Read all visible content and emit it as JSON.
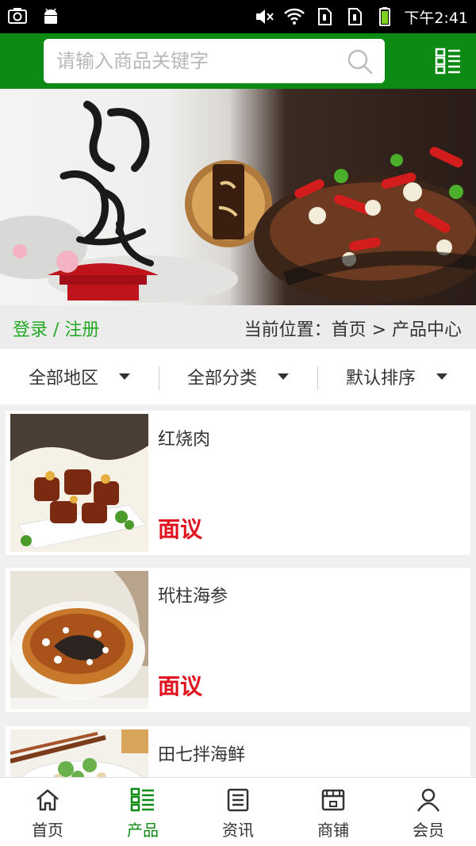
{
  "status_bar": {
    "time": "下午2:41",
    "left_icons": [
      "screenshot-icon",
      "android-icon"
    ],
    "right_icons": [
      "mute-icon",
      "wifi-icon",
      "sim1-icon",
      "sim2-icon",
      "battery-icon"
    ]
  },
  "header": {
    "search_placeholder": "请输入商品关键字",
    "accent_color": "#0c8a14"
  },
  "breadcrumb": {
    "login_link": "登录 / 注册",
    "current_location": "当前位置：首页 > 产品中心"
  },
  "filters": [
    {
      "label": "全部地区"
    },
    {
      "label": "全部分类"
    },
    {
      "label": "默认排序"
    }
  ],
  "products": [
    {
      "name": "红烧肉",
      "price": "面议"
    },
    {
      "name": "玳柱海参",
      "price": "面议"
    },
    {
      "name": "田七拌海鲜",
      "price": ""
    }
  ],
  "tabs": [
    {
      "label": "首页",
      "icon": "home-icon"
    },
    {
      "label": "产品",
      "icon": "list-icon",
      "active": true
    },
    {
      "label": "资讯",
      "icon": "news-icon"
    },
    {
      "label": "商铺",
      "icon": "shop-icon"
    },
    {
      "label": "会员",
      "icon": "user-icon"
    }
  ],
  "colors": {
    "brand_green": "#0c8a14",
    "link_green": "#23a923",
    "price_red": "#e0141e"
  }
}
